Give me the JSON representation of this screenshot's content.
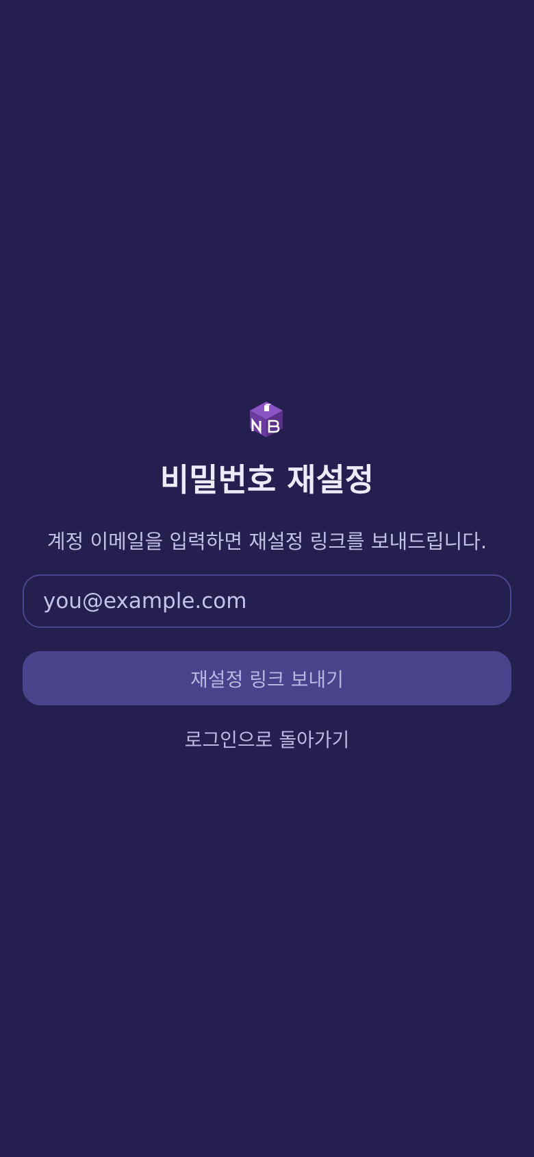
{
  "app": {
    "logo_icon": "nb-cube-logo-icon",
    "logo_letters": "NB"
  },
  "reset": {
    "title": "비밀번호 재설정",
    "subtitle": "계정 이메일을 입력하면 재설정 링크를 보내드립니다.",
    "email_placeholder": "you@example.com",
    "email_value": "",
    "send_label": "재설정 링크 보내기",
    "back_label": "로그인으로 돌아가기"
  },
  "colors": {
    "background": "#241f4f",
    "button": "#4a438b",
    "input_border": "#4b4790",
    "logo_purple": "#6a3a9c"
  }
}
